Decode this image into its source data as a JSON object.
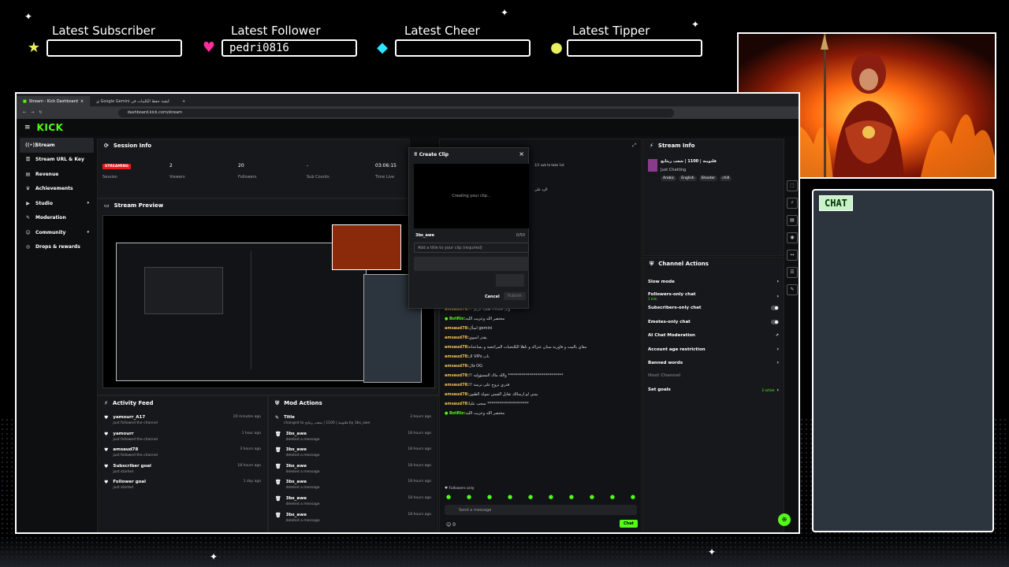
{
  "widgets": {
    "sub_label": "Latest Subscriber",
    "sub_value": "",
    "fol_label": "Latest Follower",
    "fol_value": "pedri0816",
    "cheer_label": "Latest Cheer",
    "cheer_value": "",
    "tip_label": "Latest Tipper",
    "tip_value": ""
  },
  "chat_panel": {
    "label": "CHAT"
  },
  "browser": {
    "tab1": "Stream - Kick Dashboard",
    "tab2": "ي Google Gemini كيفية حفظ الكليبات في",
    "url": "dashboard.kick.com/stream"
  },
  "kick": {
    "logo": "KICK"
  },
  "sidebar": [
    {
      "icon": "((•))",
      "label": "Stream"
    },
    {
      "icon": "⚿",
      "label": "Stream URL & Key"
    },
    {
      "icon": "▤",
      "label": "Revenue"
    },
    {
      "icon": "♛",
      "label": "Achievements"
    },
    {
      "icon": "▶",
      "label": "Studio"
    },
    {
      "icon": "✎",
      "label": "Moderation"
    },
    {
      "icon": "☺",
      "label": "Community"
    },
    {
      "icon": "◎",
      "label": "Drops & rewards"
    }
  ],
  "session": {
    "title": "Session Info",
    "status": "STREAMING",
    "status_label": "Session",
    "viewers": "2",
    "viewers_label": "Viewers",
    "followers": "20",
    "followers_label": "Followers",
    "subs": "-",
    "subs_label": "Sub Counts",
    "time": "03:06:15",
    "time_label": "Time Live"
  },
  "preview": {
    "title": "Stream Preview"
  },
  "activity": {
    "title": "Activity Feed",
    "items": [
      {
        "name": "yamourr_A17",
        "action": "just followed the channel",
        "time": "20 minutes ago"
      },
      {
        "name": "yamourr",
        "action": "just followed the channel",
        "time": "1 hour ago"
      },
      {
        "name": "amsaud78",
        "action": "just followed the channel",
        "time": "3 hours ago"
      },
      {
        "name": "Subscriber goal",
        "action": "just started",
        "time": "18 hours ago"
      },
      {
        "name": "Follower goal",
        "action": "just started",
        "time": "1 day ago"
      }
    ]
  },
  "mod": {
    "title": "Mod Actions",
    "items": [
      {
        "name": "Title",
        "action": "changed to قلتوبنة | 1100 | شعب ريثابج by 3bs_awe",
        "time": "3 hours ago"
      },
      {
        "name": "3bs_awe",
        "action": "deleted a message",
        "time": "18 hours ago"
      },
      {
        "name": "3bs_awe",
        "action": "deleted a message",
        "time": "18 hours ago"
      },
      {
        "name": "3bs_awe",
        "action": "deleted a message",
        "time": "18 hours ago"
      },
      {
        "name": "3bs_awe",
        "action": "deleted a message",
        "time": "18 hours ago"
      },
      {
        "name": "3bs_awe",
        "action": "deleted a message",
        "time": "18 hours ago"
      },
      {
        "name": "3bs_awe",
        "action": "deleted a message",
        "time": "18 hours ago"
      }
    ]
  },
  "clip": {
    "title": "Create Clip",
    "creating": "Creating your clip...",
    "user": "3bs_awe",
    "count": "0/50",
    "placeholder": "Add a title to your clip (required)",
    "cancel": "Cancel",
    "publish": "Publish"
  },
  "chat": {
    "top": "1/1 sub to take 1st",
    "line1": "الرد علي",
    "messages": [
      {
        "user": "amsaud78:",
        "text": "!! طلب كريم midia وال"
      },
      {
        "user": "BotRix:",
        "text": "مختصر الله وعزيب الليه"
      },
      {
        "user": "amsaud78:",
        "text": "اسأل gemini"
      },
      {
        "user": "amsaud78:",
        "text": "يقدر اسوي"
      },
      {
        "user": "amsaud78:",
        "text": "معاي بالبيت و فاورية سنان عنزاله و ناهلا الكلنحيات المراجعية و بساعداه"
      },
      {
        "user": "amsaud78:",
        "text": "الـ VIPs ناب"
      },
      {
        "user": "amsaud78:",
        "text": "قال OG"
      },
      {
        "user": "amsaud78:",
        "text": "!! والله ماك المسؤوليه ****************************"
      },
      {
        "user": "amsaud78:",
        "text": "!! قدري تروح على ترمية"
      },
      {
        "user": "amsaud78:",
        "text": "يمني لو ارسالك تقابل القيس تمولة الطيور"
      },
      {
        "user": "amsaud78:",
        "text": "سحب عليا *********************"
      },
      {
        "user": "BotRix:",
        "text": "مختصر الله وعزيب الليه"
      }
    ],
    "followers_only": "Followers only",
    "input_placeholder": "Send a message",
    "send": "Chat",
    "count": "0"
  },
  "streaminfo": {
    "title": "Stream Info",
    "stream_title": "قلتوبنة | 1100 | شعب ريثابج",
    "category": "Just Chatting",
    "tags": [
      "Arabic",
      "English",
      "Shooter",
      "chill"
    ]
  },
  "actions": {
    "title": "Channel Actions",
    "items": [
      {
        "label": "Slow mode",
        "sub": ""
      },
      {
        "label": "Followers-only chat",
        "sub": "1 min"
      },
      {
        "label": "Subscribers-only chat",
        "sub": ""
      },
      {
        "label": "Emotes-only chat",
        "sub": ""
      },
      {
        "label": "AI Chat Moderation",
        "sub": ""
      },
      {
        "label": "Account age restriction",
        "sub": ""
      },
      {
        "label": "Banned words",
        "sub": ""
      },
      {
        "label": "Host Channel",
        "sub": ""
      },
      {
        "label": "Set goals",
        "sub": "2 active"
      }
    ]
  },
  "colors": {
    "kick_green": "#53fc18",
    "accent_pink": "#ff2d9b",
    "accent_cyan": "#2ee6ff",
    "accent_yellow": "#e8f060"
  }
}
